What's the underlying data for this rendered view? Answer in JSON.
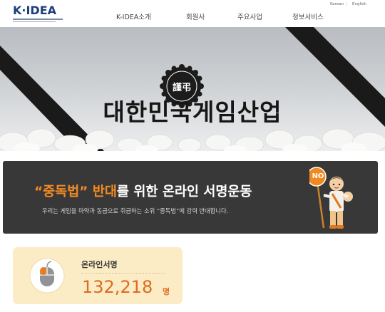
{
  "header": {
    "logo_text": "K·IDEA",
    "nav": [
      "K-IDEA소개",
      "회원사",
      "주요사업",
      "정보서비스"
    ],
    "lang": [
      "Korean",
      "English"
    ]
  },
  "banner": {
    "badge_text": "謹弔",
    "title": "대한민국게임산업"
  },
  "campaign": {
    "title_quote": "“중독법”",
    "title_accent": "반대",
    "title_rest": "를 위한 온라인 서명운동",
    "subtitle": "우리는 게임을 마약과 동급으로 취급하는 소위 “중독법”에 강력 반대합니다.",
    "sign_text": "NO"
  },
  "counter": {
    "label": "온라인서명",
    "value": "132,218",
    "unit": "명"
  },
  "colors": {
    "accent_orange": "#f18a22",
    "counter_orange": "#e06a1f",
    "campaign_bg": "#383838",
    "counter_bg": "#fbecc6",
    "logo_blue": "#1f3f7a"
  },
  "icons": [
    "mouse-icon",
    "mascot-icon",
    "mourning-ribbon-icon",
    "memorial-badge-icon"
  ]
}
